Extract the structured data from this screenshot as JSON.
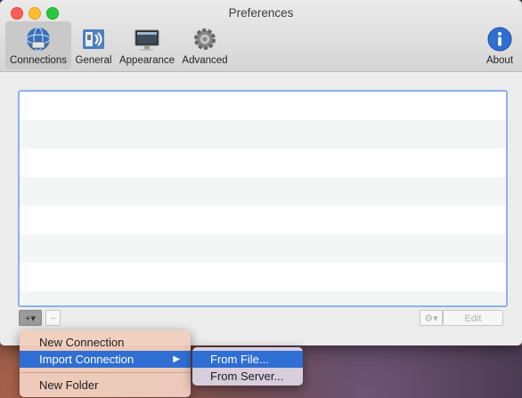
{
  "window": {
    "title": "Preferences"
  },
  "toolbar": {
    "items": [
      {
        "label": "Connections",
        "icon": "connections-icon"
      },
      {
        "label": "General",
        "icon": "general-icon"
      },
      {
        "label": "Appearance",
        "icon": "appearance-icon"
      },
      {
        "label": "Advanced",
        "icon": "gear-icon"
      }
    ],
    "about": {
      "label": "About",
      "icon": "info-icon"
    }
  },
  "bottom_bar": {
    "add_label": "+▾",
    "remove_label": "−",
    "gear_label": "⚙▾",
    "edit_label": "Edit"
  },
  "menu": {
    "items": [
      "New Connection",
      "Import Connection",
      "New Folder"
    ],
    "submenu": [
      "From File...",
      "From Server..."
    ]
  },
  "colors": {
    "accent": "#2f6ed3",
    "list_border": "#8ab2ea"
  }
}
